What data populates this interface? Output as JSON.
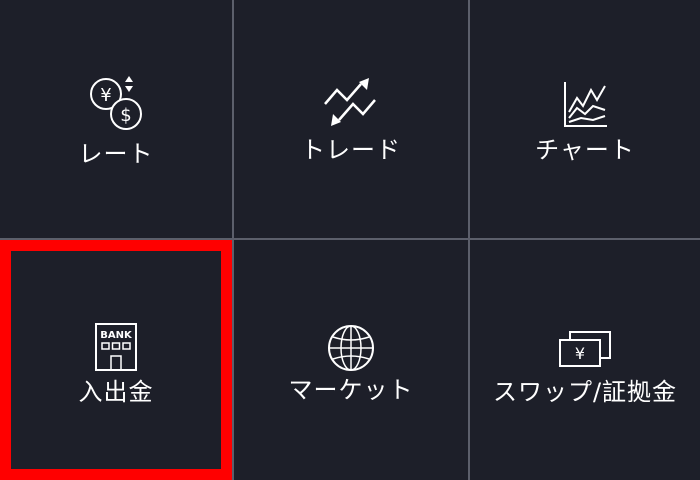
{
  "menu": {
    "rate": {
      "label": "レート",
      "icon": "currency-exchange-icon"
    },
    "trade": {
      "label": "トレード",
      "icon": "trade-arrows-icon"
    },
    "chart": {
      "label": "チャート",
      "icon": "line-chart-icon"
    },
    "deposit_withdrawal": {
      "label": "入出金",
      "icon": "bank-icon",
      "icon_text": "BANK"
    },
    "market": {
      "label": "マーケット",
      "icon": "globe-icon"
    },
    "swap_margin": {
      "label": "スワップ/証拠金",
      "icon": "banknote-icon",
      "icon_text": "¥"
    },
    "rate_icon_text": {
      "yen": "¥",
      "dollar": "$"
    }
  },
  "colors": {
    "background": "#1d1f29",
    "divider": "#5c5f6b",
    "text": "#ffffff",
    "highlight": "#ff0000"
  }
}
